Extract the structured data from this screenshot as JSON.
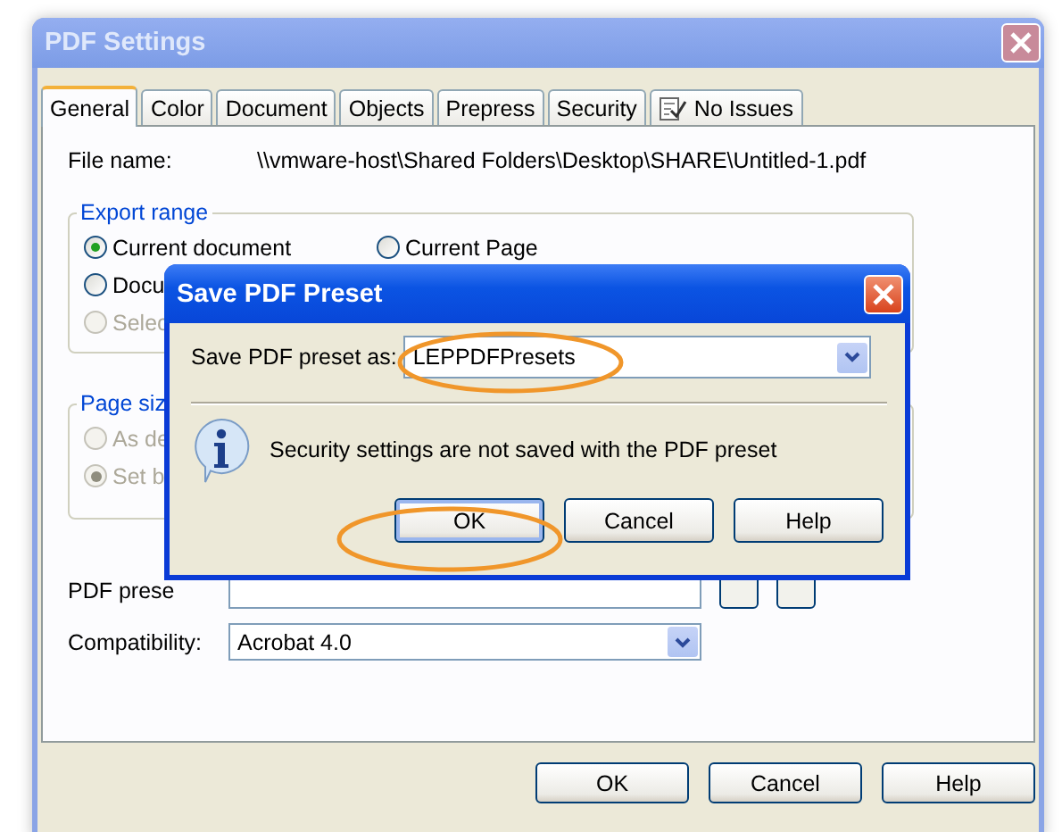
{
  "window": {
    "title": "PDF Settings"
  },
  "tabs": [
    {
      "label": "General",
      "selected": true,
      "kind": "text"
    },
    {
      "label": "Color",
      "selected": false,
      "kind": "text"
    },
    {
      "label": "Document",
      "selected": false,
      "kind": "text"
    },
    {
      "label": "Objects",
      "selected": false,
      "kind": "text"
    },
    {
      "label": "Prepress",
      "selected": false,
      "kind": "text"
    },
    {
      "label": "Security",
      "selected": false,
      "kind": "text"
    },
    {
      "label": "No Issues",
      "selected": false,
      "kind": "checklist"
    }
  ],
  "file_name": {
    "label": "File name:",
    "value": "\\\\vmware-host\\Shared Folders\\Desktop\\SHARE\\Untitled-1.pdf"
  },
  "export_range": {
    "title": "Export range",
    "options": [
      {
        "label": "Current document",
        "selected": true,
        "disabled": false
      },
      {
        "label": "Current Page",
        "selected": false,
        "disabled": false
      },
      {
        "label": "Docu",
        "selected": false,
        "disabled": false
      },
      {
        "label": "Selec",
        "selected": false,
        "disabled": true
      }
    ]
  },
  "page_size": {
    "title": "Page siz",
    "options": [
      {
        "label": "As de",
        "selected": false,
        "disabled": true
      },
      {
        "label": "Set b",
        "selected": true,
        "disabled": true
      }
    ]
  },
  "pdf_preset": {
    "label": "PDF prese"
  },
  "compatibility": {
    "label": "Compatibility:",
    "value": "Acrobat 4.0"
  },
  "buttons": [
    "OK",
    "Cancel",
    "Help"
  ],
  "dialog": {
    "title": "Save PDF Preset",
    "field_label": "Save PDF preset as:",
    "field_value": "LEPPDFPresets",
    "message": "Security settings are not saved with the PDF preset",
    "buttons": [
      {
        "label": "OK",
        "default": true
      },
      {
        "label": "Cancel",
        "default": false
      },
      {
        "label": "Help",
        "default": false
      }
    ]
  }
}
